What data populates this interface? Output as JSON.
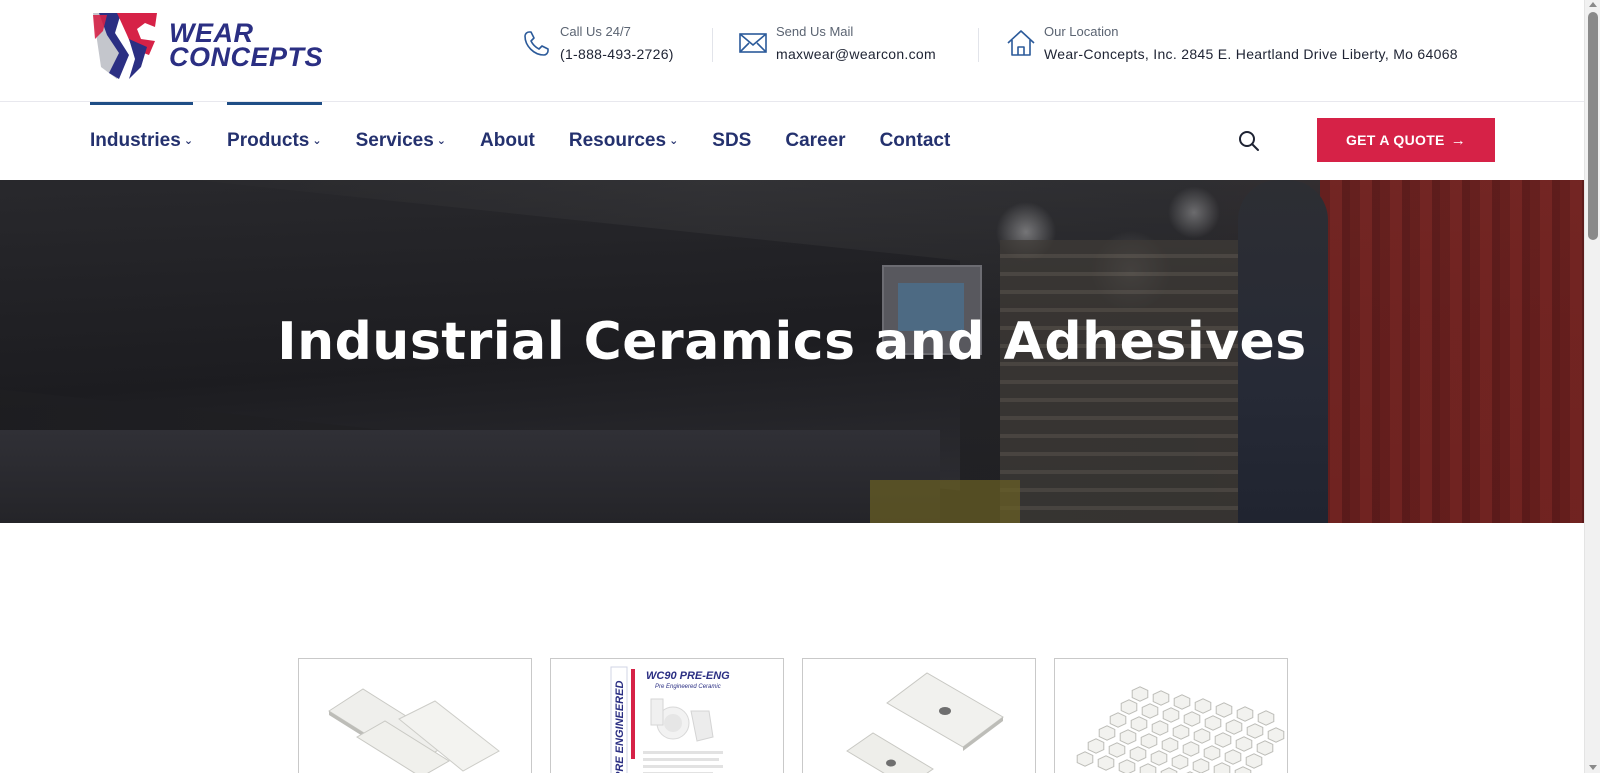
{
  "brand": {
    "line1": "WEAR",
    "line2": "CONCEPTS",
    "colors": {
      "navy": "#2b2f83",
      "red": "#d62247",
      "gray": "#c4c6cc"
    }
  },
  "contacts": {
    "phone": {
      "label": "Call Us 24/7",
      "value": "(1-888-493-2726)",
      "icon": "phone-icon"
    },
    "mail": {
      "label": "Send Us Mail",
      "value": "maxwear@wearcon.com",
      "icon": "mail-icon"
    },
    "location": {
      "label": "Our Location",
      "value": "Wear-Concepts, Inc. 2845 E. Heartland Drive Liberty, Mo 64068",
      "icon": "home-icon"
    }
  },
  "nav": {
    "items": [
      {
        "label": "Industries",
        "dropdown": true
      },
      {
        "label": "Products",
        "dropdown": true
      },
      {
        "label": "Services",
        "dropdown": true
      },
      {
        "label": "About",
        "dropdown": false
      },
      {
        "label": "Resources",
        "dropdown": true
      },
      {
        "label": "SDS",
        "dropdown": false
      },
      {
        "label": "Career",
        "dropdown": false
      },
      {
        "label": "Contact",
        "dropdown": false
      }
    ],
    "chevron": "⌄",
    "search_icon": "search-icon",
    "quote_button": "GET A QUOTE",
    "quote_arrow": "→",
    "accent_color": "#d62247",
    "nav_color": "#24316e"
  },
  "hero": {
    "title": "Industrial Ceramics and Adhesives"
  },
  "cards": {
    "items": [
      {
        "name": "ceramic-plates-product",
        "image": "two white ceramic tiles"
      },
      {
        "name": "wc90-pre-eng-product",
        "image": "WC90 PRE-ENG brochure",
        "brochure_title": "WC90 PRE-ENG",
        "brochure_subtitle": "Pre Engineered Ceramic",
        "brochure_side": "PRE ENGINEERED"
      },
      {
        "name": "weldable-ceramic-product",
        "image": "white ceramic tiles with center holes"
      },
      {
        "name": "hex-ceramic-mat-product",
        "image": "hexagonal ceramic mat"
      }
    ]
  }
}
